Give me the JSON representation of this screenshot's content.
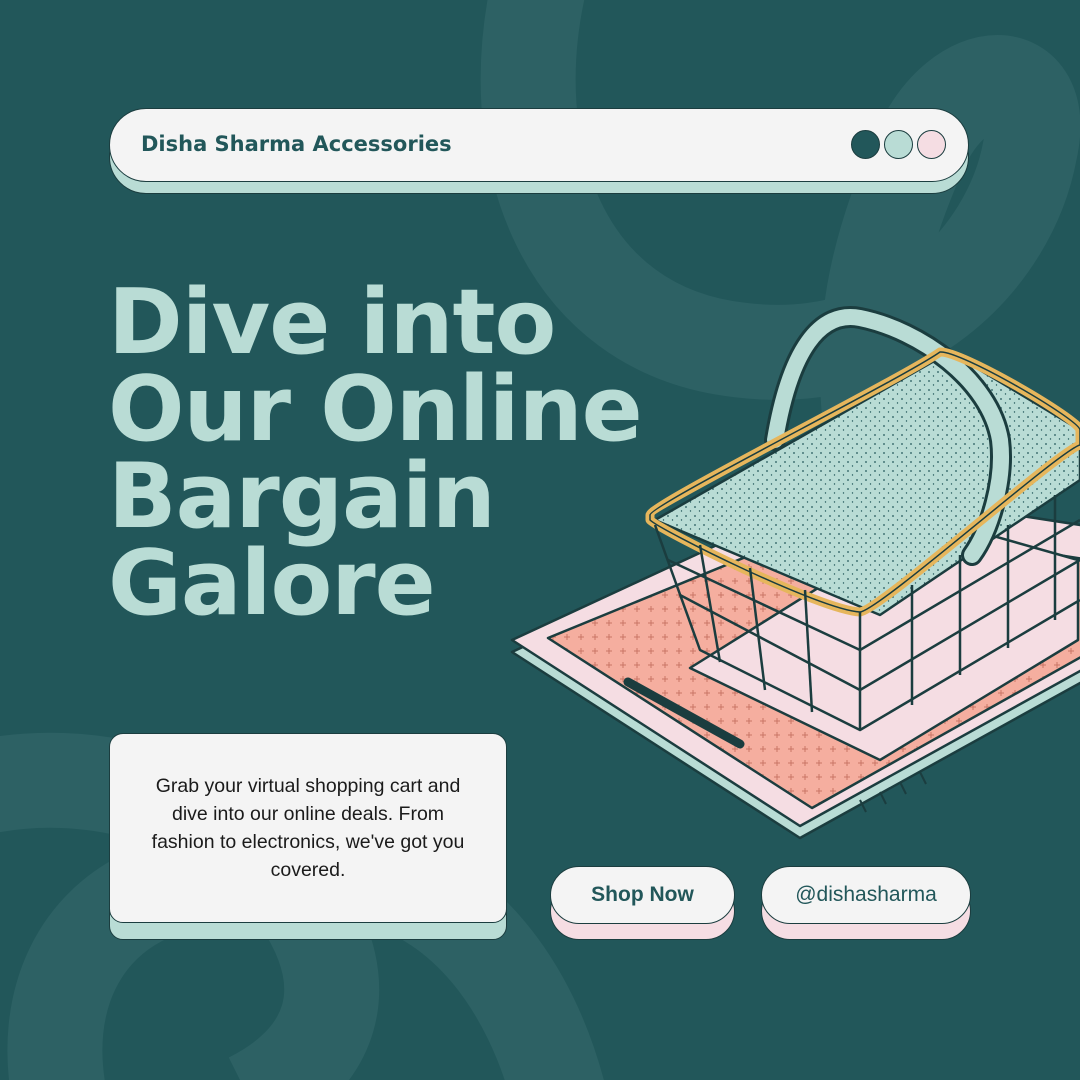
{
  "header": {
    "brand": "Disha Sharma Accessories",
    "window_dots": [
      "#22575a",
      "#b9dcd5",
      "#f5dde3"
    ]
  },
  "headline": {
    "lines": [
      "Dive into",
      "Our Online",
      "Bargain",
      "Galore"
    ]
  },
  "description": {
    "text": "Grab your virtual shopping cart and dive into our online deals. From fashion to electronics, we've got you covered."
  },
  "buttons": {
    "shop_label": "Shop Now",
    "handle_label": "@dishasharma"
  },
  "illustration": {
    "icon": "shopping-basket-icon"
  },
  "colors": {
    "background": "#22575a",
    "mint": "#b9dcd5",
    "pink": "#f5dde3",
    "salmon": "#f5ae9f",
    "gold": "#e6b65c",
    "ink": "#1b3d3f"
  }
}
